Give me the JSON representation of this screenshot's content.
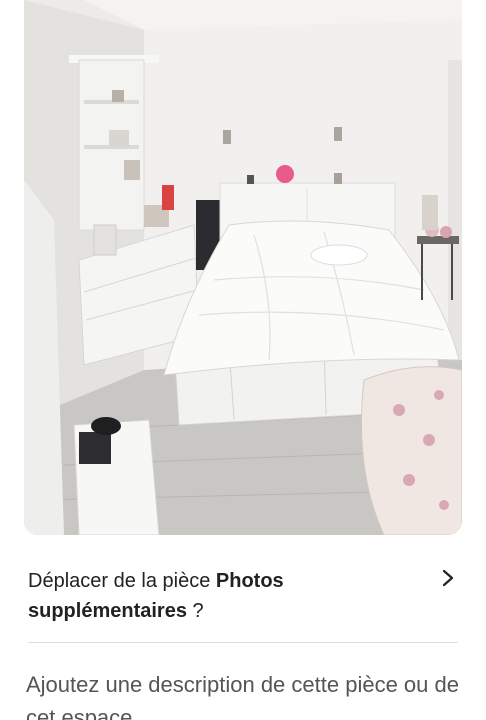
{
  "photo": {
    "description": "Bedroom photo"
  },
  "move_prompt": {
    "prefix": "Déplacer de la pièce ",
    "room_name": "Photos supplémentaires",
    "suffix": " ?",
    "icon": "chevron-right-icon"
  },
  "description_prompt": {
    "text": "Ajoutez une description de cette pièce ou de cet espace"
  },
  "colors": {
    "text_primary": "#222222",
    "text_secondary": "#555555",
    "divider": "#dddddd"
  }
}
